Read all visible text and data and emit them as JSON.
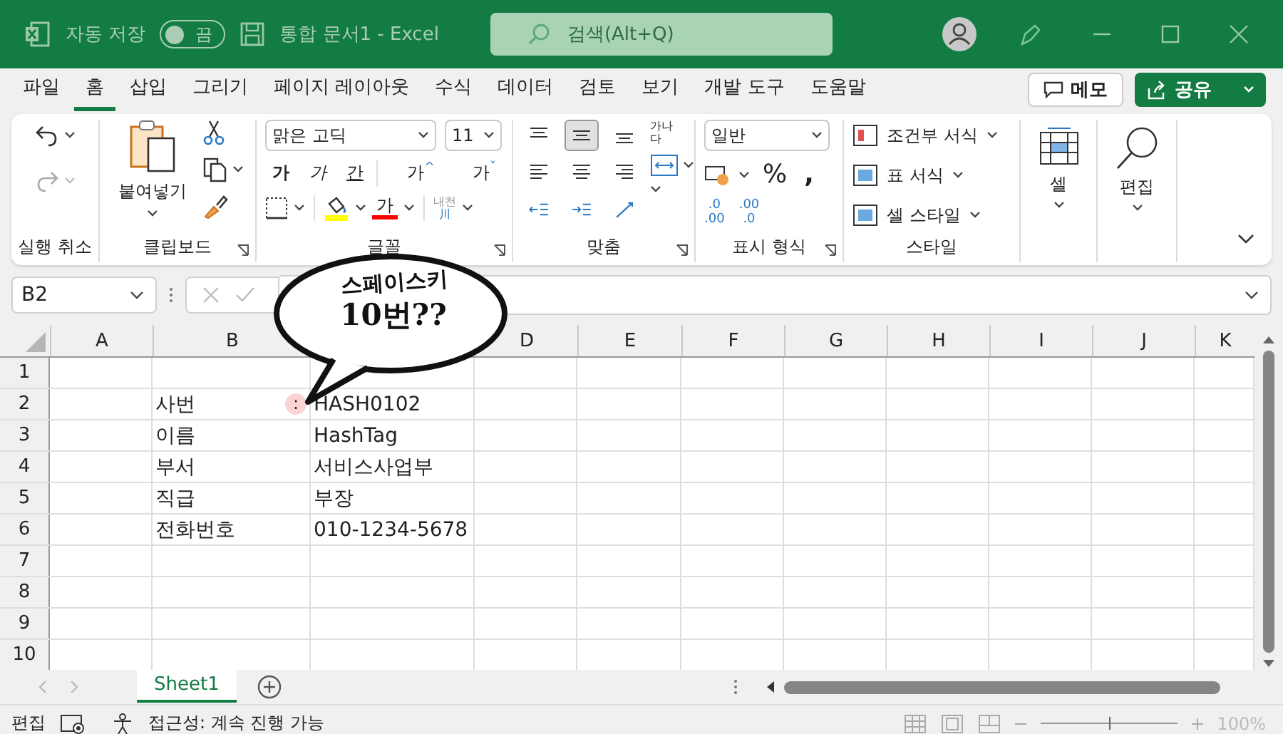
{
  "title_bar": {
    "autosave_label": "자동 저장",
    "autosave": {
      "on": false,
      "label": "끔"
    },
    "title": "통합 문서1  -  Excel",
    "search": {
      "placeholder": "검색(Alt+Q)"
    }
  },
  "tabs": [
    {
      "label": "파일",
      "selected": false
    },
    {
      "label": "홈",
      "selected": true
    },
    {
      "label": "삽입",
      "selected": false
    },
    {
      "label": "그리기",
      "selected": false
    },
    {
      "label": "페이지 레이아웃",
      "selected": false
    },
    {
      "label": "수식",
      "selected": false
    },
    {
      "label": "데이터",
      "selected": false
    },
    {
      "label": "검토",
      "selected": false
    },
    {
      "label": "보기",
      "selected": false
    },
    {
      "label": "개발 도구",
      "selected": false
    },
    {
      "label": "도움말",
      "selected": false
    }
  ],
  "memo_button": "메모",
  "share_button": "공유",
  "ribbon": {
    "groups": [
      "실행 취소",
      "클립보드",
      "글꼴",
      "맞춤",
      "표시 형식",
      "스타일"
    ],
    "paste": "붙여넣기",
    "font_name": "맑은 고딕",
    "font_size": "11",
    "font_buttons": [
      {
        "kind": "bold",
        "label": "가"
      },
      {
        "kind": "italic",
        "label": "가"
      },
      {
        "kind": "underline",
        "label": "간"
      },
      {
        "kind": "grow",
        "label": "가",
        "sign": "^"
      },
      {
        "kind": "shrink",
        "label": "가",
        "sign": "ˇ"
      }
    ],
    "fill": {
      "color": "#ffff00"
    },
    "font_color": {
      "label": "가",
      "color": "#ff0000"
    },
    "phonetic": {
      "top": "내천",
      "bottom": "川"
    },
    "align_top": [
      {
        "selected": false
      },
      {
        "selected": true
      },
      {
        "selected": false
      }
    ],
    "wrap_label": "가나다",
    "number_format": "일반",
    "percent": "%",
    "comma": ",",
    "inc_decimal": {
      "top": ".0",
      "bottom": ".00"
    },
    "dec_decimal": {
      "top": ".00",
      "bottom": ".0"
    },
    "styles": [
      "조건부 서식",
      "표 서식",
      "셀 스타일"
    ],
    "cells": "셀",
    "editing": "편집"
  },
  "name_box": "B2",
  "columns": [
    {
      "label": "A"
    },
    {
      "label": "B"
    },
    {},
    {
      "label": "D"
    },
    {
      "label": "E"
    },
    {
      "label": "F"
    },
    {
      "label": "G"
    },
    {
      "label": "H"
    },
    {
      "label": "I"
    },
    {
      "label": "J"
    },
    {
      "label": "K"
    }
  ],
  "rows": [
    {
      "n": "1"
    },
    {
      "n": "2",
      "label": "사번",
      "mark": ":",
      "value": "HASH0102"
    },
    {
      "n": "3",
      "label": "이름",
      "value": "HashTag"
    },
    {
      "n": "4",
      "label": "부서",
      "value": "서비스사업부"
    },
    {
      "n": "5",
      "label": "직급",
      "value": "부장"
    },
    {
      "n": "6",
      "label": "전화번호",
      "value": "010-1234-5678"
    },
    {
      "n": "7"
    },
    {
      "n": "8"
    },
    {
      "n": "9"
    },
    {
      "n": "10"
    }
  ],
  "sheets": [
    {
      "label": "Sheet1",
      "selected": true
    }
  ],
  "status_bar": {
    "mode": "편집",
    "accessibility": "접근성: 계속 진행 가능",
    "zoom": {
      "level": 0.5,
      "reading": "100%"
    }
  },
  "callout": {
    "lines": [
      "스페이스키",
      "10번??"
    ]
  }
}
